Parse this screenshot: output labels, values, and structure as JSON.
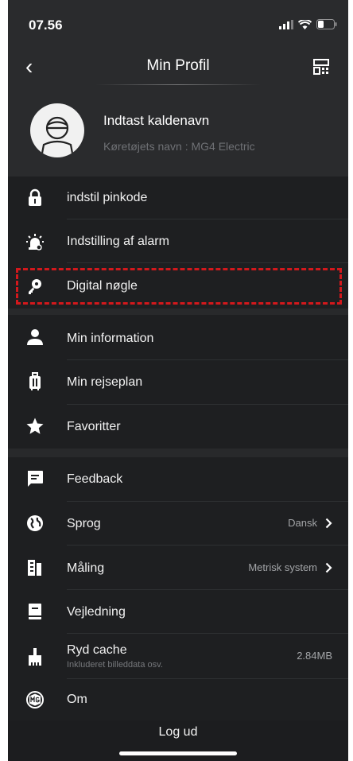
{
  "status": {
    "time": "07.56"
  },
  "header": {
    "title": "Min Profil"
  },
  "profile": {
    "nickname": "Indtast kaldenavn",
    "vehicle": "Køretøjets navn : MG4 Electric"
  },
  "section1": [
    {
      "label": "indstil pinkode",
      "icon": "lock-icon"
    },
    {
      "label": "Indstilling af alarm",
      "icon": "alarm-light-icon"
    },
    {
      "label": "Digital nøgle",
      "icon": "key-icon"
    }
  ],
  "section2": [
    {
      "label": "Min information",
      "icon": "person-icon"
    },
    {
      "label": "Min rejseplan",
      "icon": "luggage-icon"
    },
    {
      "label": "Favoritter",
      "icon": "star-icon"
    }
  ],
  "section3": [
    {
      "label": "Feedback",
      "icon": "message-icon"
    },
    {
      "label": "Sprog",
      "value": "Dansk",
      "icon": "globe-icon"
    },
    {
      "label": "Måling",
      "value": "Metrisk system",
      "icon": "measurement-icon"
    },
    {
      "label": "Vejledning",
      "icon": "guide-book-icon"
    },
    {
      "label": "Ryd cache",
      "sublabel": "Inkluderet billeddata osv.",
      "value": "2.84MB",
      "icon": "broom-icon"
    },
    {
      "label": "Om",
      "icon": "mg-logo-icon"
    }
  ],
  "footer": {
    "logout": "Log ud"
  },
  "colors": {
    "background": "#1e1f21",
    "card": "#2a2b2d",
    "highlight": "#d3181c",
    "text": "#ffffff",
    "muted": "#6f7175"
  }
}
